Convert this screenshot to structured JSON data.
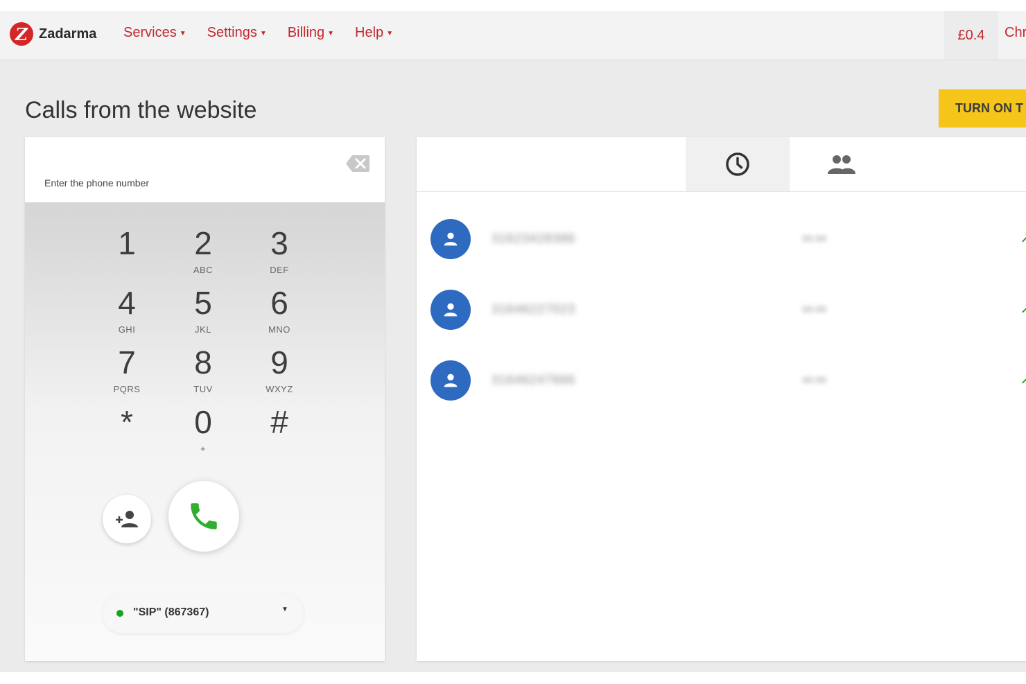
{
  "header": {
    "logo_mark": "Z",
    "logo_text": "Zadarma",
    "menu": [
      {
        "label": "Services"
      },
      {
        "label": "Settings"
      },
      {
        "label": "Billing"
      },
      {
        "label": "Help"
      }
    ],
    "balance": "£0.4",
    "user_label": "Chr"
  },
  "page": {
    "title": "Calls from the website",
    "turn_on_button": "TURN ON T"
  },
  "dialer": {
    "placeholder": "Enter the phone number",
    "keys": [
      {
        "digit": "1",
        "letters": ""
      },
      {
        "digit": "2",
        "letters": "ABC"
      },
      {
        "digit": "3",
        "letters": "DEF"
      },
      {
        "digit": "4",
        "letters": "GHI"
      },
      {
        "digit": "5",
        "letters": "JKL"
      },
      {
        "digit": "6",
        "letters": "MNO"
      },
      {
        "digit": "7",
        "letters": "PQRS"
      },
      {
        "digit": "8",
        "letters": "TUV"
      },
      {
        "digit": "9",
        "letters": "WXYZ"
      },
      {
        "digit": "*",
        "letters": ""
      },
      {
        "digit": "0",
        "letters": "+"
      },
      {
        "digit": "#",
        "letters": ""
      }
    ],
    "sip_label": "\"SIP\" (867367)"
  },
  "history": {
    "calls": [
      {
        "number": "31623428386",
        "time": "00:00",
        "direction": "↗"
      },
      {
        "number": "31646227023",
        "time": "00:00",
        "direction": "↗"
      },
      {
        "number": "31646247666",
        "time": "00:00",
        "direction": "↗"
      }
    ]
  },
  "colors": {
    "brand_red": "#c0282f",
    "accent_yellow": "#f5c519",
    "avatar_blue": "#2e6bc0",
    "call_green": "#1aa21a"
  }
}
